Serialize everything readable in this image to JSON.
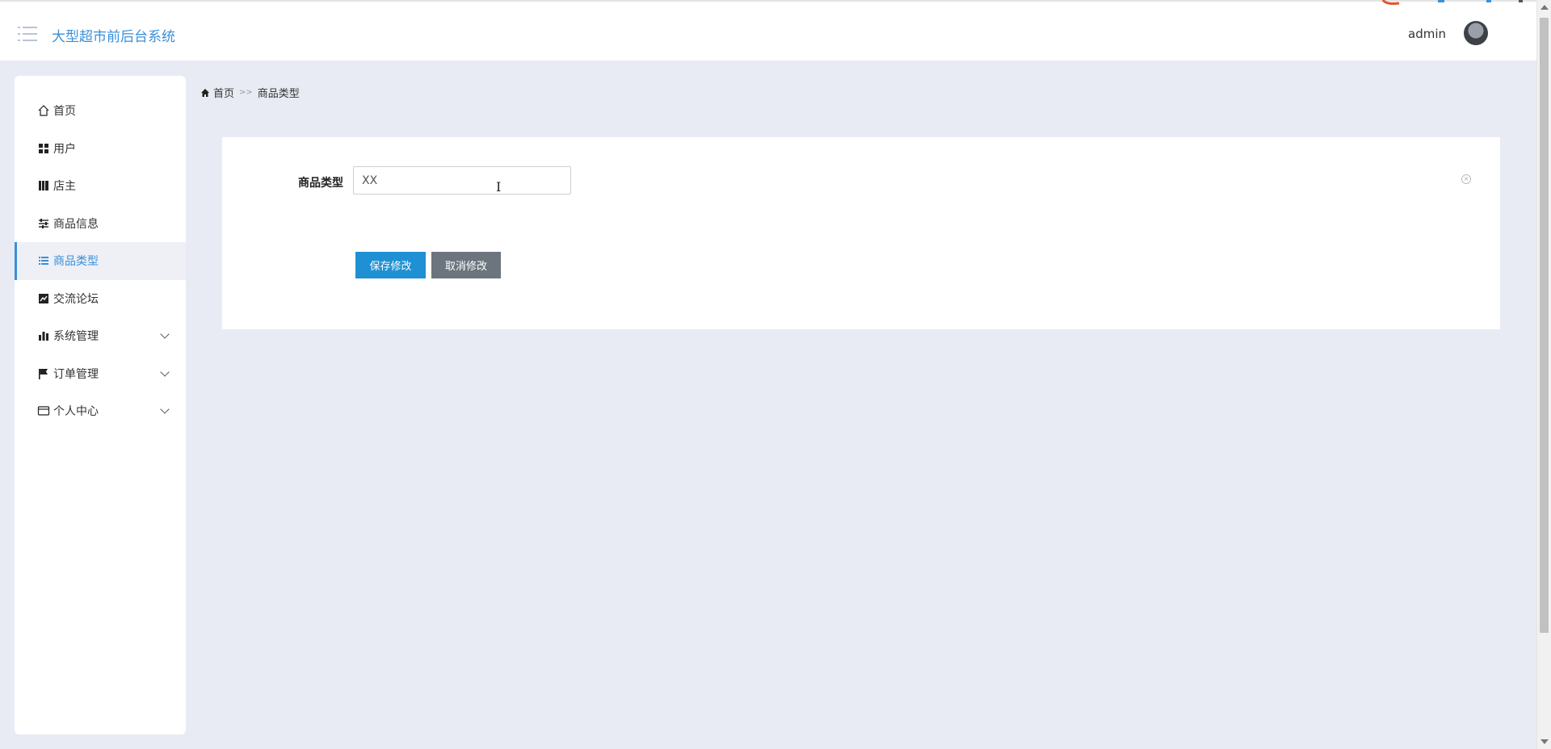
{
  "header": {
    "app_title": "大型超市前后台系统",
    "user_name": "admin"
  },
  "sidebar": {
    "items": [
      {
        "label": "首页",
        "icon": "home-icon",
        "active": false,
        "expandable": false
      },
      {
        "label": "用户",
        "icon": "grid-icon",
        "active": false,
        "expandable": false
      },
      {
        "label": "店主",
        "icon": "book-icon",
        "active": false,
        "expandable": false
      },
      {
        "label": "商品信息",
        "icon": "sliders-icon",
        "active": false,
        "expandable": false
      },
      {
        "label": "商品类型",
        "icon": "list-icon",
        "active": true,
        "expandable": false
      },
      {
        "label": "交流论坛",
        "icon": "chart-line-icon",
        "active": false,
        "expandable": false
      },
      {
        "label": "系统管理",
        "icon": "bar-chart-icon",
        "active": false,
        "expandable": true
      },
      {
        "label": "订单管理",
        "icon": "flag-icon",
        "active": false,
        "expandable": true
      },
      {
        "label": "个人中心",
        "icon": "card-icon",
        "active": false,
        "expandable": true
      }
    ]
  },
  "breadcrumb": {
    "home": "首页",
    "separator": ">>",
    "current": "商品类型"
  },
  "form": {
    "label": "商品类型",
    "value": "XX",
    "save_label": "保存修改",
    "cancel_label": "取消修改"
  },
  "colors": {
    "accent": "#3a8fd9",
    "save_button": "#1e90d3",
    "cancel_button": "#6c757d",
    "background": "#e9ebf4"
  }
}
